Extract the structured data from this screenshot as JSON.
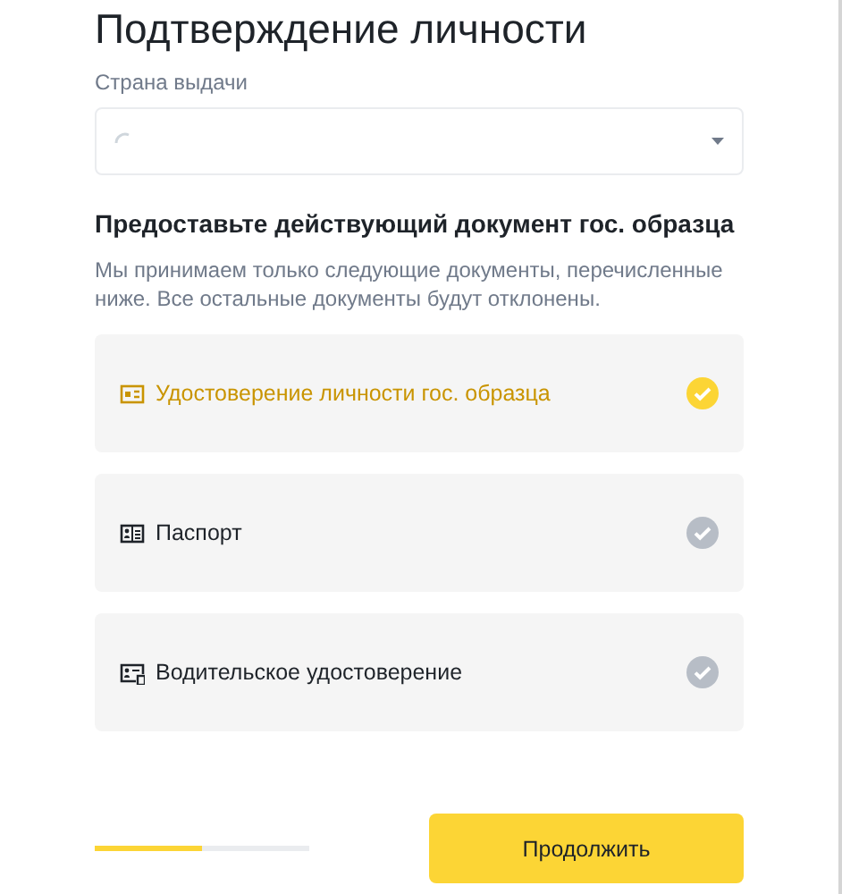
{
  "title": "Подтверждение личности",
  "country": {
    "label": "Страна выдачи",
    "loading": true
  },
  "heading": "Предоставьте действующий документ гос. образца",
  "description": "Мы принимаем только следующие документы, перечисленные ниже. Все остальные документы будут отклонены.",
  "documents": [
    {
      "kind": "id-card",
      "label": "Удостоверение личности гос. образца",
      "selected": true
    },
    {
      "kind": "passport",
      "label": "Паспорт",
      "selected": false
    },
    {
      "kind": "license",
      "label": "Водительское удостоверение",
      "selected": false
    }
  ],
  "progress": {
    "level": 0.5
  },
  "continue_button": "Продолжить"
}
